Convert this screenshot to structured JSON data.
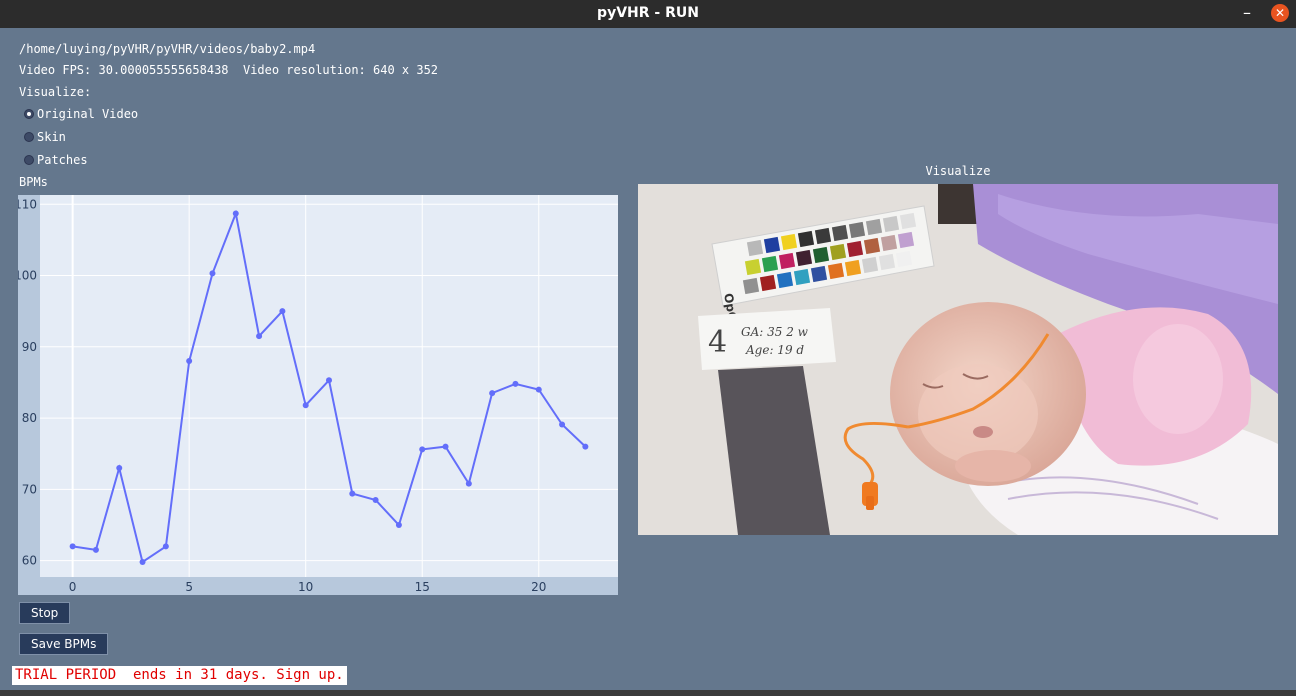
{
  "window": {
    "title": "pyVHR - RUN"
  },
  "info": {
    "path": "/home/luying/pyVHR/pyVHR/videos/baby2.mp4",
    "fps_line": "Video FPS: 30.000055555658438  Video resolution: 640 x 352",
    "visualize_label": "Visualize:"
  },
  "visualize_options": [
    {
      "label": "Original Video",
      "selected": true
    },
    {
      "label": "Skin",
      "selected": false
    },
    {
      "label": "Patches",
      "selected": false
    }
  ],
  "bpm_label": "BPMs",
  "visualize_title": "Visualize",
  "chart_data": {
    "type": "line",
    "x": [
      0,
      1,
      2,
      3,
      4,
      5,
      6,
      7,
      8,
      9,
      10,
      11,
      12,
      13,
      14,
      15,
      16,
      17,
      18,
      19,
      20,
      21,
      22
    ],
    "y": [
      62.0,
      61.5,
      73.0,
      59.8,
      62.0,
      88.0,
      100.3,
      108.7,
      91.5,
      95.0,
      81.8,
      85.3,
      69.4,
      68.5,
      65.0,
      75.6,
      76.0,
      70.8,
      83.5,
      84.8,
      84.0,
      79.1,
      76.0
    ],
    "xticks": [
      0,
      5,
      10,
      15,
      20
    ],
    "yticks": [
      60,
      70,
      80,
      90,
      100,
      110
    ],
    "xlim": [
      -1.4,
      23.4
    ],
    "ylim": [
      57.7,
      111.3
    ],
    "grid": true,
    "line_color": "#636efa",
    "plot_bg": "#e5ecf6"
  },
  "video": {
    "card_label": "OpCARD",
    "note_number": "4",
    "note_line1": "GA: 35 2 w",
    "note_line2": "Age: 19 d"
  },
  "buttons": {
    "stop": "Stop",
    "save": "Save BPMs"
  },
  "trial_text": "TRIAL PERIOD  ends in 31 days. Sign up.",
  "colors": {
    "background": "#64778d",
    "button": "#283b5b",
    "trial_text": "#e00000"
  }
}
